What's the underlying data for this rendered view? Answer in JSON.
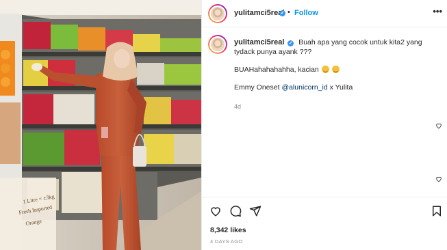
{
  "post": {
    "author": {
      "username": "yulitamci5real",
      "verified_mark": "✓",
      "separator": "•",
      "follow_label": "Follow"
    },
    "more_icon": "more-horizontal-icon",
    "more_glyph": "•••",
    "caption": {
      "username": "yulitamci5real",
      "line1": "Buah apa yang cocok untuk kita2 yang tydack punya ayank ???",
      "line2": "BUAHahahahahha, kacian",
      "line2_emojis": [
        "grinning-face-emoji",
        "grinning-face-emoji"
      ],
      "line3_prefix": "Emmy Oneset ",
      "line3_mention": "@alunicorn_id",
      "line3_suffix": " x Yulita",
      "time_ago": "4d"
    },
    "likes": "8,342 likes",
    "posted": "4 DAYS AGO"
  },
  "icons": {
    "like": "heart-icon",
    "comment": "comment-icon",
    "share": "send-icon",
    "save": "bookmark-icon"
  },
  "colors": {
    "follow_blue": "#0095f6",
    "verified_blue": "#3897f0",
    "text": "#262626",
    "muted": "#8e8e8e",
    "mention": "#00376b",
    "border": "#efefef"
  },
  "media": {
    "sign_text_line1": "1 Litre = ±3kg",
    "sign_text_line2": "Fresh Imported",
    "sign_text_line3": "Orange"
  }
}
